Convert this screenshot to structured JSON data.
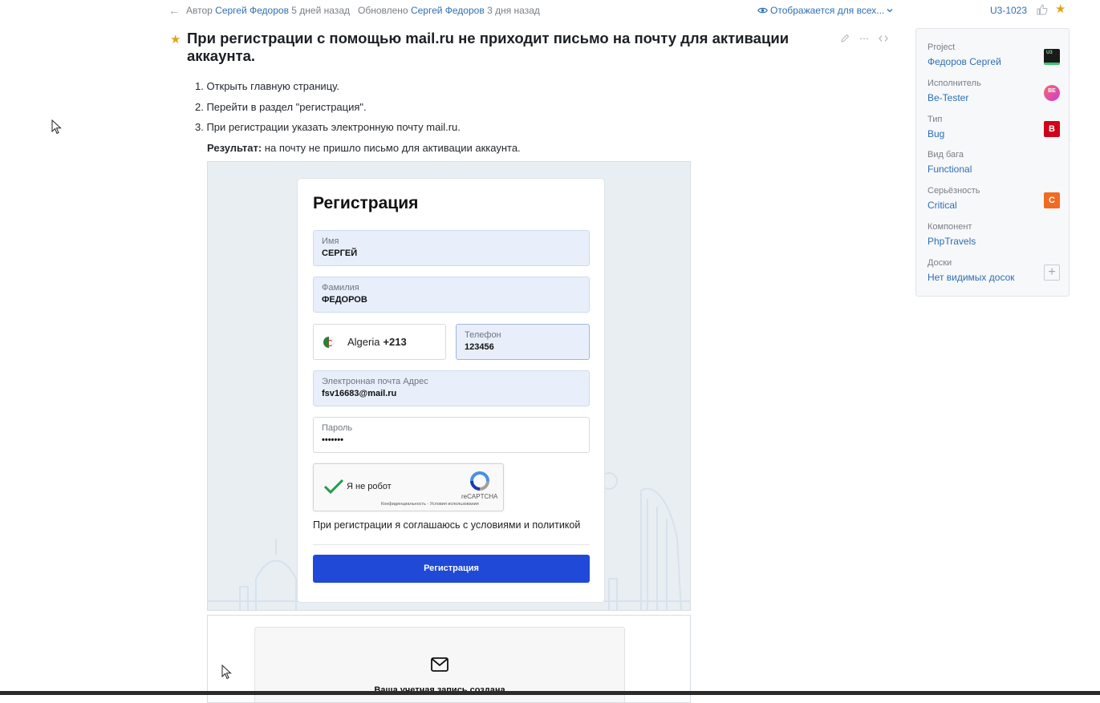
{
  "meta": {
    "author_prefix": "Автор",
    "author_name": "Сергей Федоров",
    "author_time": "5 дней назад",
    "updated_prefix": "Обновлено",
    "updated_name": "Сергей Федоров",
    "updated_time": "3 дня назад",
    "visibility": "Отображается для всех...",
    "issue_id": "U3-1023"
  },
  "issue": {
    "title": "При регистрации с помощью mail.ru не приходит письмо на почту для активации аккаунта.",
    "steps": [
      "1. Открыть главную страницу.",
      "2. Перейти в раздел \"регистрация\".",
      "3. При регистрации указать электронную почту mail.ru."
    ],
    "result_label": "Результат:",
    "result_text": " на почту не пришло письмо для активации аккаунта."
  },
  "registration_form": {
    "title": "Регистрация",
    "name_label": "Имя",
    "name_value": "СЕРГЕЙ",
    "surname_label": "Фамилия",
    "surname_value": "ФЕДОРОВ",
    "country_name": "Algeria",
    "country_code": "+213",
    "phone_label": "Телефон",
    "phone_value": "123456",
    "email_label": "Электронная почта Адрес",
    "email_value": "fsv16683@mail.ru",
    "password_label": "Пароль",
    "password_value": "•••••••",
    "captcha_label": "Я не робот",
    "captcha_brand": "reCAPTCHA",
    "captcha_links": "Конфиденциальность - Условия использования",
    "agree_text": "При регистрации я соглашаюсь с условиями и политикой",
    "submit_label": "Регистрация"
  },
  "confirmation": {
    "text": "Ваша учетная запись создана"
  },
  "sidebar": {
    "items": [
      {
        "label": "Project",
        "value": "Федоров Сергей",
        "badge": "U3"
      },
      {
        "label": "Исполнитель",
        "value": "Be-Tester",
        "badge": "BE"
      },
      {
        "label": "Тип",
        "value": "Bug",
        "badge": "B"
      },
      {
        "label": "Вид бага",
        "value": "Functional"
      },
      {
        "label": "Серьёзность",
        "value": "Critical",
        "badge": "C"
      },
      {
        "label": "Компонент",
        "value": "PhpTravels"
      },
      {
        "label": "Доски",
        "value": "Нет видимых досок",
        "badge": "+"
      }
    ]
  },
  "colors": {
    "link": "#2f6fb3",
    "star": "#e3a21a",
    "primary_button": "#1f49d6",
    "bug_badge": "#d0021b",
    "critical_badge": "#f26a21"
  }
}
